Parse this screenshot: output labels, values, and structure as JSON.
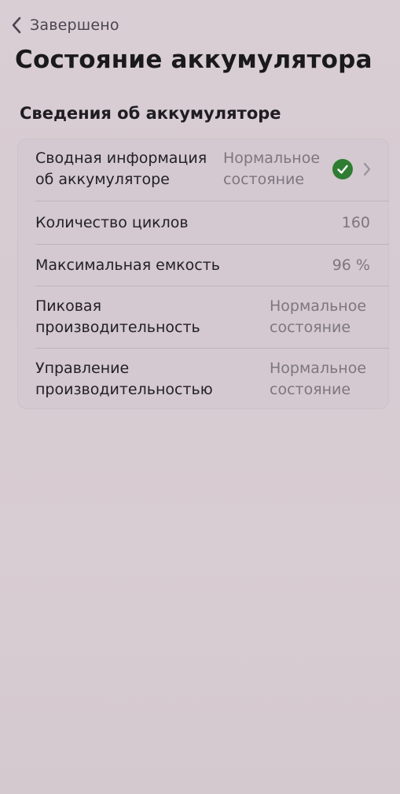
{
  "nav": {
    "back_label": "Завершено",
    "back_icon": "chevron-left-icon"
  },
  "page": {
    "title": "Состояние аккумулятора"
  },
  "section": {
    "title": "Сведения об аккумуляторе"
  },
  "rows": [
    {
      "label_line1": "Сводная информация",
      "label_line2": "об аккумуляторе",
      "value_line1": "Нормальное",
      "value_line2": "состояние",
      "status_icon": "green-check-icon",
      "status_color": "#2e7d32",
      "has_chevron": true
    },
    {
      "label": "Количество циклов",
      "value": "160"
    },
    {
      "label": "Максимальная емкость",
      "value": "96 %"
    },
    {
      "label_line1": "Пиковая",
      "label_line2": "производительность",
      "value_line1": "Нормальное",
      "value_line2": "состояние"
    },
    {
      "label_line1": "Управление",
      "label_line2": "производительностью",
      "value_line1": "Нормальное",
      "value_line2": "состояние"
    }
  ]
}
